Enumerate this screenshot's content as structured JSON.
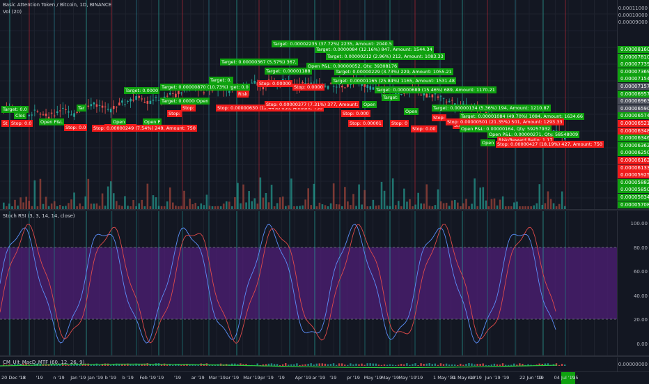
{
  "header": {
    "title": "Basic Attention Token / Bitcoin, 1D, BINANCE",
    "volume": "Vol (20)"
  },
  "indicators": {
    "stoch": "Stoch RSI (3, 3, 14, 14, close)",
    "macd": "CM_Ult_MacD_MTF (60, 12, 26, 9)"
  },
  "price_axis": {
    "grid_labels": [
      "0.00011000",
      "0.00010000",
      "0.00009000"
    ],
    "tags": [
      {
        "text": "0.00008160",
        "color": "#0fa10f"
      },
      {
        "text": "0.00007810",
        "color": "#0fa10f"
      },
      {
        "text": "0.00007739",
        "color": "#0fa10f"
      },
      {
        "text": "0.00007369",
        "color": "#0fa10f"
      },
      {
        "text": "0.00007154",
        "color": "#0fa10f"
      },
      {
        "text": "0.00007157",
        "color": "#4a4e5a"
      },
      {
        "text": "0.00006957",
        "color": "#0fa10f"
      },
      {
        "text": "0.00006963",
        "color": "#4a4e5a"
      },
      {
        "text": "0.00006590",
        "color": "#4a4e5a"
      },
      {
        "text": "0.00006574",
        "color": "#0fa10f"
      },
      {
        "text": "0.00006521",
        "color": "#f01b1b"
      },
      {
        "text": "0.00006348",
        "color": "#f01b1b"
      },
      {
        "text": "0.00006346",
        "color": "#0fa10f"
      },
      {
        "text": "0.00006362",
        "color": "#0fa10f"
      },
      {
        "text": "0.00006250",
        "color": "#0fa10f"
      },
      {
        "text": "0.00006162",
        "color": "#f01b1b"
      },
      {
        "text": "0.00006133",
        "color": "#f01b1b"
      },
      {
        "text": "0.00005925",
        "color": "#f01b1b"
      },
      {
        "text": "0.00005882",
        "color": "#0fa10f"
      },
      {
        "text": "0.00005850",
        "color": "#0fa10f"
      },
      {
        "text": "0.00005834",
        "color": "#0fa10f"
      },
      {
        "text": "0.00005708",
        "color": "#0fa10f"
      }
    ]
  },
  "rsi_axis": [
    "100.00",
    "80.00",
    "60.00",
    "40.00",
    "20.00",
    "0.00"
  ],
  "macd_axis": "0.00000000",
  "dates": [
    "20 Dec '18",
    "'18",
    "'19",
    "n '19",
    "Jan '19",
    "Jan '19",
    "b '19",
    "b '19",
    "Feb '19",
    "'19",
    "'19",
    "ar '19",
    "Mar '19",
    "ar '19",
    "Mar '19",
    "pr '19",
    "'19",
    "Apr '19",
    "ar '19",
    "'19",
    "pr '19",
    "May '19",
    "May '19",
    "May '19",
    "'19",
    "1 May '19",
    "31 May '19",
    "ne '19",
    "Jun '19",
    "'19",
    "22 Jun '19",
    "'19",
    "04 Jul '19",
    "'15"
  ],
  "trade_labels": [
    {
      "text": "Target: 0.00002235 (37.72%) 2235, Amount: 2040.5",
      "c": "g"
    },
    {
      "text": "Target: 0.0000084 (12.16%) 847, Amount: 1544.34",
      "c": "g"
    },
    {
      "text": "Target: 0.00000212 (2.96%) 212, Amount: 1083.33",
      "c": "g"
    },
    {
      "text": "Target: 0.00000367 (5.57%) 367,",
      "c": "g"
    },
    {
      "text": "Open P&L: 0.00000052, Qty: 39308176",
      "c": "g"
    },
    {
      "text": "Target: 0.00001188",
      "c": "g"
    },
    {
      "text": "Target: 0.00000229 (3.73%) 229, Amount: 1055.21",
      "c": "g"
    },
    {
      "text": "Target: 0.00000870 (10.73%)",
      "c": "g"
    },
    {
      "text": "Target: 0.00001165 (25.84%) 1165, Amount: 1531.48",
      "c": "g"
    },
    {
      "text": "Target: 0.00000689 (15.46%) 689, Amount: 1170.21",
      "c": "g"
    },
    {
      "text": "Stop: 0.00000630 (12.44%) 630, Amount: 750",
      "c": "r"
    },
    {
      "text": "Stop: 0.00000377 (7.31%) 377, Amount:",
      "c": "r"
    },
    {
      "text": "Target: 0.00000134 (5.36%) 194, Amount: 1210.87",
      "c": "g"
    },
    {
      "text": "Target: 0.00001084 (49.70%) 1084, Amount: 1634.66",
      "c": "g"
    },
    {
      "text": "Stop: 0.00000501 (21.35%) 501, Amount: 1293.33",
      "c": "r"
    },
    {
      "text": "Open P&L: 0.00000164, Qty: 59257932",
      "c": "g"
    },
    {
      "text": "Open P&L: 0.00000271, Qty: 58548009",
      "c": "g"
    },
    {
      "text": "Risk/Reward Ratio: 1.17",
      "c": "r"
    },
    {
      "text": "Stop: 0.00000427 (18.19%) 427, Amount: 750",
      "c": "r"
    },
    {
      "text": "Stop: 0.00000249 (7.54%) 249, Amount: 750",
      "c": "r"
    }
  ]
}
